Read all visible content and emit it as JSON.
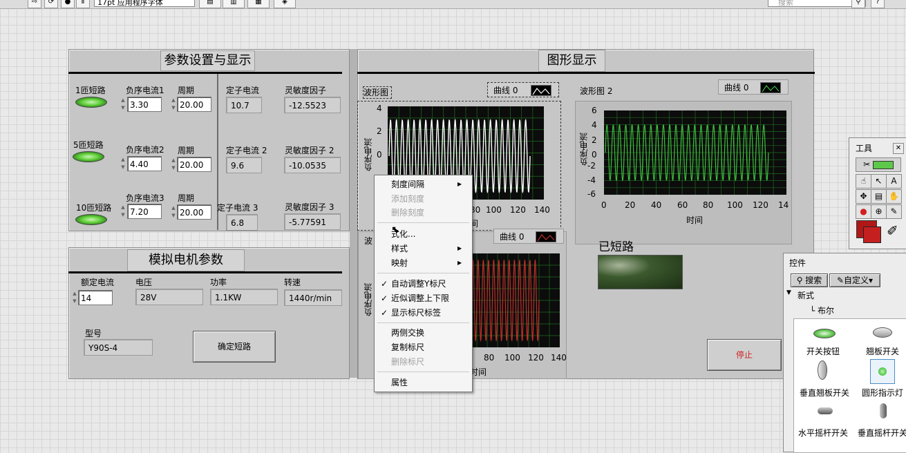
{
  "toolbar": {
    "font_selector": "17pt 应用程序字体",
    "search_placeholder": "搜索"
  },
  "params_panel": {
    "title": "参数设置与显示",
    "rows": [
      {
        "short_label": "1匝短路",
        "current_label": "负序电流1",
        "current_value": "3.30",
        "period_label": "周期",
        "period_value": "20.00",
        "stator_label": "定子电流",
        "stator_value": "10.7",
        "sens_label": "灵敏度因子",
        "sens_value": "-12.5523"
      },
      {
        "short_label": "5匝短路",
        "current_label": "负序电流2",
        "current_value": "4.40",
        "period_label": "周期",
        "period_value": "20.00",
        "stator_label": "定子电流 2",
        "stator_value": "9.6",
        "sens_label": "灵敏度因子 2",
        "sens_value": "-10.0535"
      },
      {
        "short_label": "10匝短路",
        "current_label": "负序电流3",
        "current_value": "7.20",
        "period_label": "周期",
        "period_value": "20.00",
        "stator_label": "定子电流 3",
        "stator_value": "6.8",
        "sens_label": "灵敏度因子 3",
        "sens_value": "-5.77591"
      }
    ]
  },
  "motor_panel": {
    "title": "模拟电机参数",
    "rated_current_label": "额定电流",
    "rated_current_value": "14",
    "voltage_label": "电压",
    "voltage_value": "28V",
    "power_label": "功率",
    "power_value": "1.1KW",
    "speed_label": "转速",
    "speed_value": "1440r/min",
    "model_label": "型号",
    "model_value": "Y90S-4",
    "confirm_button": "确定短路"
  },
  "graph_panel": {
    "title": "图形显示",
    "graph1": {
      "label": "波形图",
      "legend": "曲线 0",
      "ylabel": "负序电流",
      "yticks": [
        "4",
        "2",
        "0"
      ],
      "xticks": [
        "80",
        "100",
        "120",
        "140"
      ],
      "xlabel": "间"
    },
    "graph2": {
      "label": "波形图 2",
      "legend": "曲线 0",
      "ylabel": "负序电流",
      "yticks": [
        "6",
        "4",
        "2",
        "0",
        "-2",
        "-4",
        "-6"
      ],
      "xticks": [
        "0",
        "20",
        "40",
        "60",
        "80",
        "100",
        "120",
        "14"
      ],
      "xlabel": "时间"
    },
    "graph3": {
      "label": "波",
      "legend": "曲线 0",
      "ylabel": "负序电流",
      "xticks": [
        "80",
        "100",
        "120",
        "140"
      ],
      "xlabel": "时间"
    },
    "shorted_label": "已短路",
    "stop_button": "停止"
  },
  "context_menu": {
    "items": [
      {
        "label": "刻度间隔",
        "submenu": true
      },
      {
        "label": "添加刻度",
        "disabled": true
      },
      {
        "label": "删除刻度",
        "disabled": true
      },
      {
        "label": "格式化...",
        "visible": "式化..."
      },
      {
        "label": "样式",
        "submenu": true
      },
      {
        "label": "映射",
        "submenu": true
      },
      {
        "label": "自动调整Y标尺",
        "checked": true
      },
      {
        "label": "近似调整上下限",
        "checked": true
      },
      {
        "label": "显示标尺标签",
        "checked": true
      },
      {
        "label": "两侧交换"
      },
      {
        "label": "复制标尺"
      },
      {
        "label": "删除标尺",
        "disabled": true
      },
      {
        "label": "属性"
      }
    ]
  },
  "tools_palette": {
    "title": "工具"
  },
  "controls_palette": {
    "title": "控件",
    "search_button": "搜索",
    "customize_button": "自定义",
    "tree": {
      "root": "新式",
      "child": "布尔"
    },
    "items": [
      "开关按钮",
      "翘板开关",
      "垂直翘板开关",
      "圆形指示灯",
      "水平摇杆开关",
      "垂直摇杆开关"
    ]
  },
  "colors": {
    "plot_bg": "#0c0c0c",
    "grid": "#1f6b1f",
    "graph1_trace": "#ffffff",
    "graph2_trace": "#3fbf3f",
    "graph3_trace": "#c0302a",
    "stop_text": "#d02020"
  }
}
